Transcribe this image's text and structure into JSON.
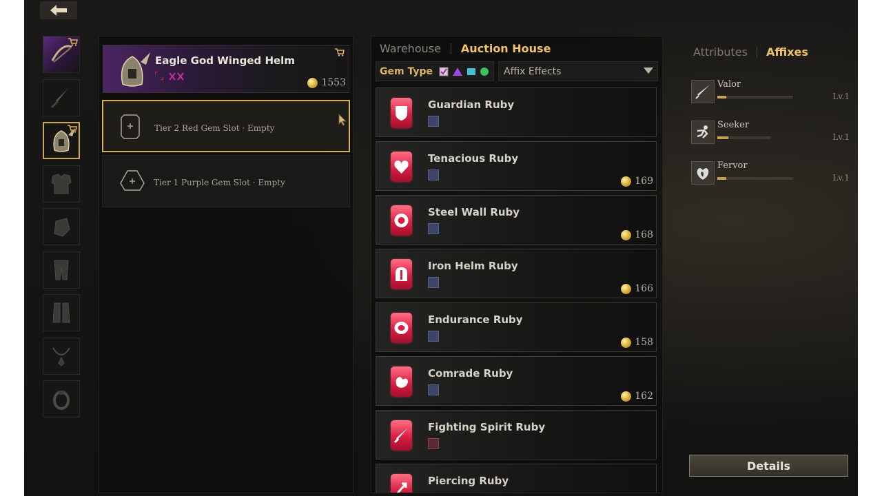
{
  "nav": {
    "back_icon": "arrow-left-icon"
  },
  "equipment_slots": [
    {
      "name": "crossbow",
      "icon": "crossbow-icon",
      "shop": true
    },
    {
      "name": "dagger",
      "icon": "dagger-icon",
      "shop": false
    },
    {
      "name": "helm",
      "icon": "helm-icon",
      "shop": true,
      "active": true
    },
    {
      "name": "chest-armor",
      "icon": "chest-armor-icon",
      "shop": false
    },
    {
      "name": "gauntlets",
      "icon": "gauntlets-icon",
      "shop": false
    },
    {
      "name": "leg-armor",
      "icon": "leg-armor-icon",
      "shop": false
    },
    {
      "name": "boots",
      "icon": "boots-icon",
      "shop": false
    },
    {
      "name": "necklace",
      "icon": "necklace-icon",
      "shop": false
    },
    {
      "name": "ring",
      "icon": "ring-icon",
      "shop": false
    }
  ],
  "item": {
    "title": "Eagle God Winged Helm",
    "price": "1553"
  },
  "gem_slots": [
    {
      "label": "Tier 2 Red Gem Slot · Empty",
      "selected": true
    },
    {
      "label": "Tier 1 Purple Gem Slot · Empty",
      "selected": false
    }
  ],
  "market": {
    "tabs": [
      {
        "label": "Warehouse",
        "active": false
      },
      {
        "label": "Auction House",
        "active": true
      }
    ],
    "gem_type_label": "Gem Type",
    "affix_filter_label": "Affix Effects",
    "items": [
      {
        "name": "Guardian Ruby",
        "price": ""
      },
      {
        "name": "Tenacious Ruby",
        "price": "169"
      },
      {
        "name": "Steel Wall Ruby",
        "price": "168"
      },
      {
        "name": "Iron Helm Ruby",
        "price": "166"
      },
      {
        "name": "Endurance Ruby",
        "price": "158"
      },
      {
        "name": "Comrade Ruby",
        "price": "162"
      },
      {
        "name": "Fighting Spirit Ruby",
        "price": ""
      },
      {
        "name": "Piercing Ruby",
        "price": ""
      }
    ]
  },
  "affix_panel": {
    "tabs": [
      {
        "label": "Attributes",
        "active": false
      },
      {
        "label": "Affixes",
        "active": true
      }
    ],
    "affixes": [
      {
        "name": "Valor",
        "level": "Lv.1",
        "progress": 0.12
      },
      {
        "name": "Seeker",
        "level": "Lv.1",
        "progress": 0.2
      },
      {
        "name": "Fervor",
        "level": "Lv.1",
        "progress": 0.12
      }
    ],
    "details_label": "Details"
  },
  "colors": {
    "accent_gold": "#f0c36a",
    "ruby": "#e0304f",
    "selected_border": "#d8b04a"
  }
}
